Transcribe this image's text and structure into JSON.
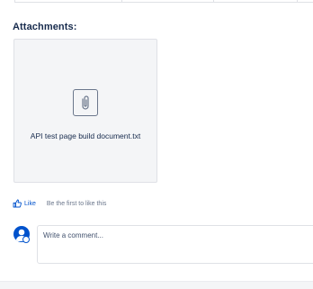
{
  "attachments": {
    "title": "Attachments:",
    "items": [
      {
        "name": "API test page build document.txt",
        "icon": "paperclip-icon"
      }
    ]
  },
  "likes": {
    "like_label": "Like",
    "summary": "Be the first to like this"
  },
  "comment": {
    "placeholder": "Write a comment..."
  },
  "colors": {
    "link": "#0052cc",
    "text": "#172b4d",
    "muted": "#6b778c",
    "card_bg": "#f4f5f7",
    "border": "#dfe1e6"
  }
}
